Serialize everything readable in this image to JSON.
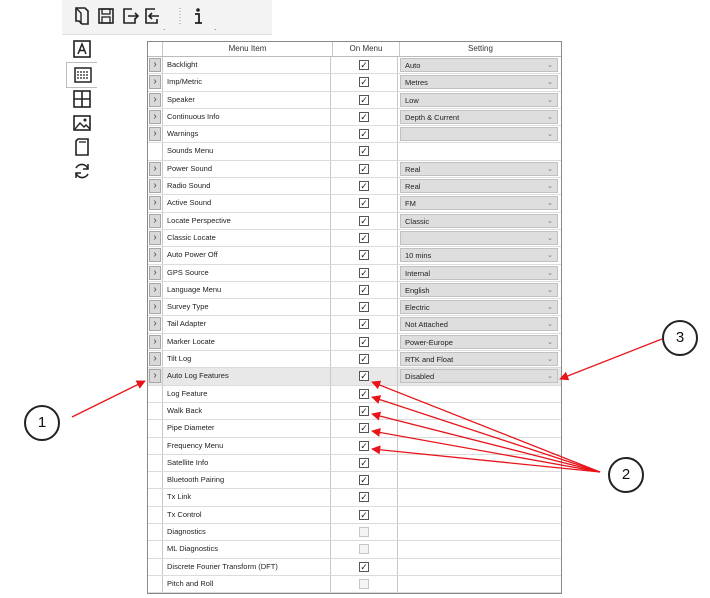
{
  "toolbar": {
    "buttons": [
      {
        "icon": "document-icon"
      },
      {
        "icon": "save-icon"
      },
      {
        "icon": "export-icon"
      },
      {
        "icon": "import-icon"
      },
      {
        "icon": "info-icon"
      }
    ]
  },
  "sidebar": {
    "items": [
      {
        "icon": "text-icon"
      },
      {
        "icon": "menu-grid-icon",
        "selected": true
      },
      {
        "icon": "table-icon"
      },
      {
        "icon": "image-icon"
      },
      {
        "icon": "sd-card-icon"
      },
      {
        "icon": "refresh-icon"
      }
    ]
  },
  "grid": {
    "headers": [
      "Menu Item",
      "On Menu",
      "Setting"
    ],
    "rows": [
      {
        "label": "Backlight",
        "arrow": true,
        "checked": true,
        "setting": "Auto"
      },
      {
        "label": "Imp/Metric",
        "arrow": true,
        "checked": true,
        "setting": "Metres"
      },
      {
        "label": "Speaker",
        "arrow": true,
        "checked": true,
        "setting": "Low"
      },
      {
        "label": "Continuous Info",
        "arrow": true,
        "checked": true,
        "setting": "Depth & Current"
      },
      {
        "label": "Warnings",
        "arrow": true,
        "checked": true,
        "setting": ""
      },
      {
        "label": "Sounds Menu",
        "arrow": false,
        "checked": true
      },
      {
        "label": "Power Sound",
        "arrow": true,
        "checked": true,
        "setting": "Real"
      },
      {
        "label": "Radio Sound",
        "arrow": true,
        "checked": true,
        "setting": "Real"
      },
      {
        "label": "Active Sound",
        "arrow": true,
        "checked": true,
        "setting": "FM"
      },
      {
        "label": "Locate Perspective",
        "arrow": true,
        "checked": true,
        "setting": "Classic"
      },
      {
        "label": "Classic Locate",
        "arrow": true,
        "checked": true,
        "setting": ""
      },
      {
        "label": "Auto Power Off",
        "arrow": true,
        "checked": true,
        "setting": "10 mins"
      },
      {
        "label": "GPS Source",
        "arrow": true,
        "checked": true,
        "setting": "Internal"
      },
      {
        "label": "Language Menu",
        "arrow": true,
        "checked": true,
        "setting": "English"
      },
      {
        "label": "Survey Type",
        "arrow": true,
        "checked": true,
        "setting": "Electric"
      },
      {
        "label": "Tail Adapter",
        "arrow": true,
        "checked": true,
        "setting": "Not Attached"
      },
      {
        "label": "Marker Locate",
        "arrow": true,
        "checked": true,
        "setting": "Power-Europe"
      },
      {
        "label": "Tilt Log",
        "arrow": true,
        "checked": true,
        "setting": "RTK and Float"
      },
      {
        "label": "Auto Log Features",
        "arrow": true,
        "checked": true,
        "setting": "Disabled",
        "selected": true
      },
      {
        "label": "Log Feature",
        "arrow": false,
        "checked": true
      },
      {
        "label": "Walk Back",
        "arrow": false,
        "checked": true
      },
      {
        "label": "Pipe Diameter",
        "arrow": false,
        "checked": true
      },
      {
        "label": "Frequency Menu",
        "arrow": false,
        "checked": true
      },
      {
        "label": "Satellite Info",
        "arrow": false,
        "checked": true
      },
      {
        "label": "Bluetooth Pairing",
        "arrow": false,
        "checked": true
      },
      {
        "label": "Tx Link",
        "arrow": false,
        "checked": true
      },
      {
        "label": "Tx Control",
        "arrow": false,
        "checked": true
      },
      {
        "label": "Diagnostics",
        "arrow": false,
        "checked": false
      },
      {
        "label": "ML Diagnostics",
        "arrow": false,
        "checked": false
      },
      {
        "label": "Discrete Fourier Transform (DFT)",
        "arrow": false,
        "checked": true
      },
      {
        "label": "Pitch and Roll",
        "arrow": false,
        "checked": false
      }
    ]
  },
  "callouts": [
    "1",
    "2",
    "3"
  ],
  "colors": {
    "annotation_arrow": "#e8141c"
  }
}
